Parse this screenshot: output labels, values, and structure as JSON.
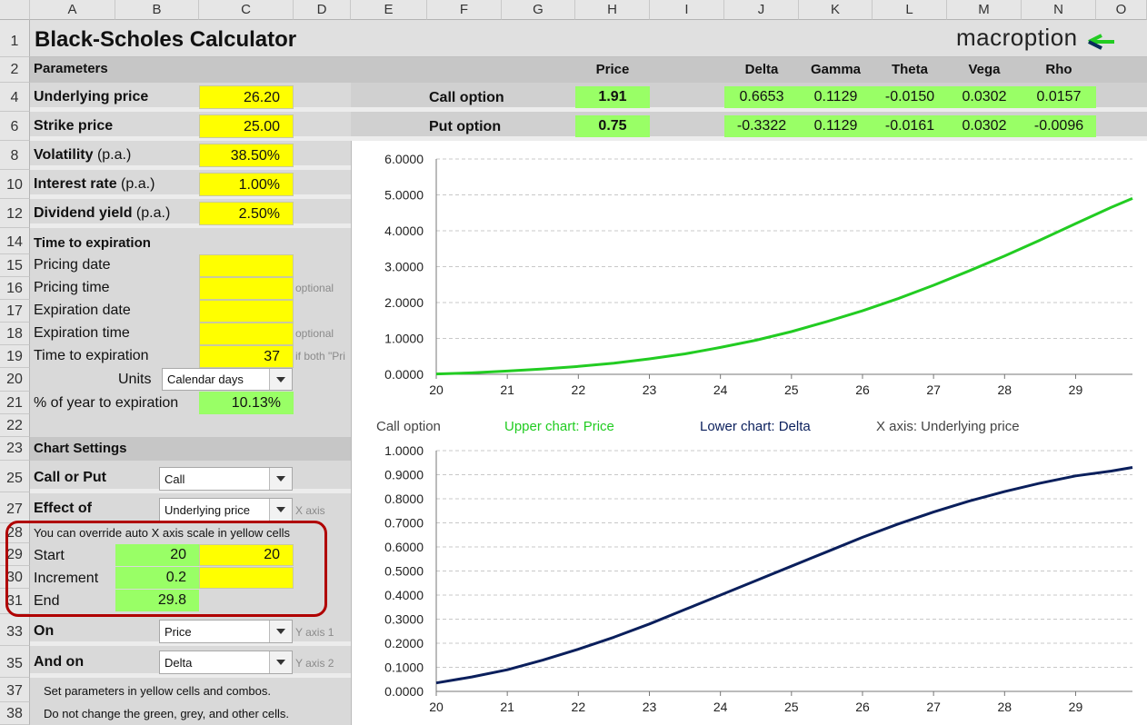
{
  "columns": [
    "A",
    "B",
    "C",
    "D",
    "E",
    "F",
    "G",
    "H",
    "I",
    "J",
    "K",
    "L",
    "M",
    "N",
    "O"
  ],
  "rows": [
    "1",
    "2",
    "4",
    "6",
    "8",
    "10",
    "12",
    "14",
    "15",
    "16",
    "17",
    "18",
    "19",
    "20",
    "21",
    "22",
    "23",
    "25",
    "27",
    "28",
    "29",
    "30",
    "31",
    "33",
    "35",
    "37",
    "38"
  ],
  "title": "Black-Scholes Calculator",
  "logo": {
    "text": "macroption",
    "accent_color": "#22cc22"
  },
  "colors": {
    "input": "#ffff00",
    "output": "#99ff66",
    "call_line": "#22cc22",
    "delta_line": "#0a1f5c",
    "highlight_border": "#b00000"
  },
  "params": {
    "header": "Parameters",
    "underlying_label": "Underlying price",
    "underlying_value": "26.20",
    "strike_label": "Strike price",
    "strike_value": "25.00",
    "vol_label": "Volatility",
    "vol_suffix": "(p.a.)",
    "vol_value": "38.50%",
    "rate_label": "Interest rate",
    "rate_suffix": "(p.a.)",
    "rate_value": "1.00%",
    "div_label": "Dividend yield",
    "div_suffix": "(p.a.)",
    "div_value": "2.50%"
  },
  "time": {
    "header": "Time to expiration",
    "pricing_date": "Pricing date",
    "pricing_time": "Pricing time",
    "expiration_date": "Expiration date",
    "expiration_time": "Expiration time",
    "optional1": "optional",
    "optional2": "optional",
    "tte_label": "Time to expiration",
    "tte_value": "37",
    "if_both": "if both \"Pri",
    "units_label": "Units",
    "units_value": "Calendar days",
    "pct_label": "% of year to expiration",
    "pct_value": "10.13%"
  },
  "chart_settings": {
    "header": "Chart Settings",
    "call_put_label": "Call or Put",
    "call_put_value": "Call",
    "effect_label": "Effect of",
    "effect_value": "Underlying price",
    "x_axis_note": "X axis",
    "override_note": "You can override auto X axis scale in yellow cells",
    "start_label": "Start",
    "start_auto": "20",
    "start_override": "20",
    "increment_label": "Increment",
    "increment_auto": "0.2",
    "end_label": "End",
    "end_auto": "29.8",
    "on_label": "On",
    "on_value": "Price",
    "y1_note": "Y axis 1",
    "and_on_label": "And on",
    "and_on_value": "Delta",
    "y2_note": "Y axis 2",
    "tip1": "Set parameters in yellow cells and combos.",
    "tip2": "Do not change the green, grey, and other cells."
  },
  "results": {
    "headers": {
      "price": "Price",
      "delta": "Delta",
      "gamma": "Gamma",
      "theta": "Theta",
      "vega": "Vega",
      "rho": "Rho"
    },
    "call": {
      "label": "Call option",
      "price": "1.91",
      "delta": "0.6653",
      "gamma": "0.1129",
      "theta": "-0.0150",
      "vega": "0.0302",
      "rho": "0.0157"
    },
    "put": {
      "label": "Put option",
      "price": "0.75",
      "delta": "-0.3322",
      "gamma": "0.1129",
      "theta": "-0.0161",
      "vega": "0.0302",
      "rho": "-0.0096"
    }
  },
  "legend": {
    "option": "Call option",
    "upper": "Upper chart: Price",
    "lower": "Lower chart: Delta",
    "xaxis": "X axis: Underlying price"
  },
  "chart_data": [
    {
      "type": "line",
      "title": "",
      "xlim": [
        20,
        29.8
      ],
      "ylim": [
        0,
        6
      ],
      "x_ticks": [
        "20",
        "21",
        "22",
        "23",
        "24",
        "25",
        "26",
        "27",
        "28",
        "29"
      ],
      "y_ticks": [
        "0.0000",
        "1.0000",
        "2.0000",
        "3.0000",
        "4.0000",
        "5.0000",
        "6.0000"
      ],
      "grid": true,
      "series": [
        {
          "name": "",
          "color": "#22cc22",
          "x": [
            20,
            20.5,
            21,
            21.5,
            22,
            22.5,
            23,
            23.5,
            24,
            24.5,
            25,
            25.5,
            26,
            26.5,
            27,
            27.5,
            28,
            28.5,
            29,
            29.5,
            29.8
          ],
          "values": [
            0.01,
            0.04,
            0.09,
            0.15,
            0.22,
            0.31,
            0.43,
            0.57,
            0.75,
            0.95,
            1.19,
            1.47,
            1.77,
            2.11,
            2.48,
            2.88,
            3.3,
            3.74,
            4.2,
            4.65,
            4.9
          ]
        }
      ]
    },
    {
      "type": "line",
      "title": "",
      "xlim": [
        20,
        29.8
      ],
      "ylim": [
        0,
        1
      ],
      "x_ticks": [
        "20",
        "21",
        "22",
        "23",
        "24",
        "25",
        "26",
        "27",
        "28",
        "29"
      ],
      "y_ticks": [
        "0.0000",
        "0.1000",
        "0.2000",
        "0.3000",
        "0.4000",
        "0.5000",
        "0.6000",
        "0.7000",
        "0.8000",
        "0.9000",
        "1.0000"
      ],
      "grid": true,
      "series": [
        {
          "name": "",
          "color": "#0a1f5c",
          "x": [
            20,
            20.5,
            21,
            21.5,
            22,
            22.5,
            23,
            23.5,
            24,
            24.5,
            25,
            25.5,
            26,
            26.5,
            27,
            27.5,
            28,
            28.5,
            29,
            29.5,
            29.8
          ],
          "values": [
            0.035,
            0.06,
            0.09,
            0.13,
            0.175,
            0.225,
            0.28,
            0.34,
            0.4,
            0.46,
            0.52,
            0.58,
            0.64,
            0.695,
            0.745,
            0.79,
            0.83,
            0.865,
            0.895,
            0.915,
            0.93
          ]
        }
      ]
    }
  ]
}
